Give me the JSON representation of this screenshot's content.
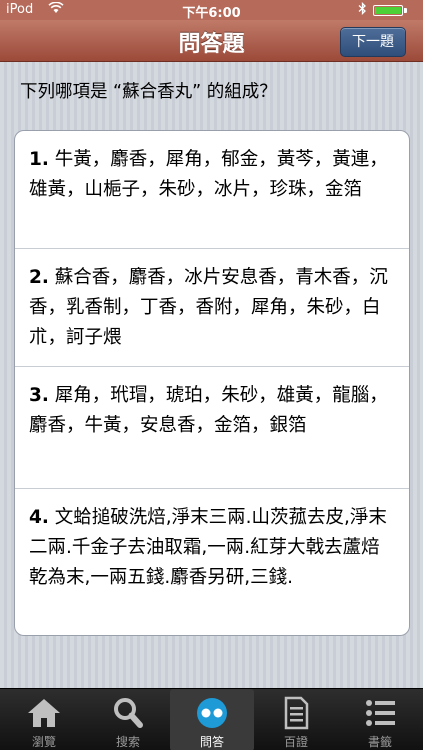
{
  "status_bar": {
    "carrier": "iPod",
    "time": "下午6:00"
  },
  "navbar": {
    "title": "問答題",
    "next_label": "下一題"
  },
  "question": "下列哪項是 “蘇合香丸” 的組成？",
  "options": [
    {
      "num": "1.",
      "text": " 牛黃，麝香，犀角，郁金，黃芩，黃連，雄黃，山梔子，朱砂，冰片，珍珠，金箔"
    },
    {
      "num": "2.",
      "text": " 蘇合香，麝香，冰片安息香，青木香，沉香，乳香制，丁香，香附，犀角，朱砂，白朮，訶子煨"
    },
    {
      "num": "3.",
      "text": " 犀角，玳瑁，琥珀，朱砂，雄黃，龍腦，麝香，牛黃，安息香，金箔，銀箔"
    },
    {
      "num": "4.",
      "text": " 文蛤搥破洗焙,淨末三兩.山茨菰去皮,淨末二兩.千金子去油取霜,一兩.紅芽大戟去蘆焙乾為末,一兩五錢.麝香另研,三錢."
    }
  ],
  "tabs": [
    {
      "label": "瀏覽",
      "icon": "home-icon"
    },
    {
      "label": "搜索",
      "icon": "search-icon"
    },
    {
      "label": "問答",
      "icon": "quiz-icon",
      "active": true
    },
    {
      "label": "百證",
      "icon": "document-icon"
    },
    {
      "label": "書籤",
      "icon": "list-icon"
    }
  ],
  "colors": {
    "navbar": "#b0604f",
    "button": "#3b5a86",
    "battery": "#4cd137"
  }
}
